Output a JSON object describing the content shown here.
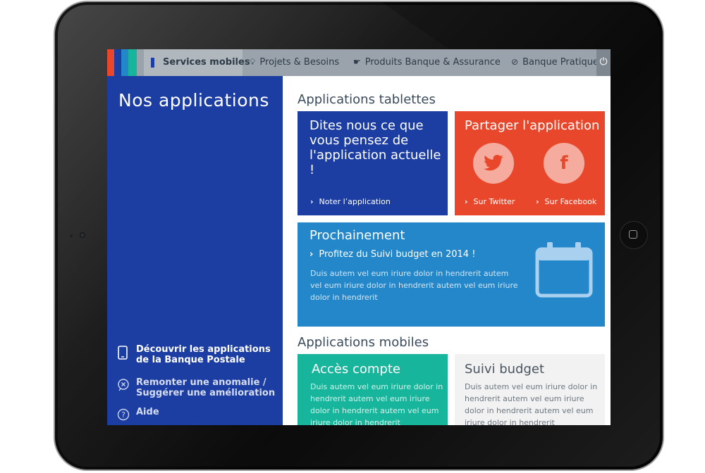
{
  "nav": {
    "items": [
      {
        "label": "Services mobiles",
        "icon": "phone-icon"
      },
      {
        "label": "Projets & Besoins",
        "icon": "lightbulb-icon"
      },
      {
        "label": "Produits Banque & Assurance",
        "icon": "handshake-icon"
      },
      {
        "label": "Banque Pratique",
        "icon": "compass-icon"
      }
    ],
    "power_icon": "power-icon"
  },
  "sidebar": {
    "title": "Nos applications",
    "menu": [
      {
        "label": "Découvrir les applications de la Banque Postale",
        "icon": "tablet-icon"
      },
      {
        "label": "Remonter une anomalie / Suggérer une amélioration",
        "icon": "bug-report-icon"
      },
      {
        "label": "Aide",
        "icon": "help-icon"
      }
    ]
  },
  "main": {
    "tablet_section": "Applications tablettes",
    "mobile_section": "Applications mobiles",
    "feedback": {
      "title": "Dites nous ce que vous pensez de l'application actuelle !",
      "link": "Noter l’application"
    },
    "share": {
      "title": "Partager l'application",
      "twitter": "Sur Twitter",
      "facebook": "Sur Facebook"
    },
    "upcoming": {
      "title": "Prochainement",
      "subtitle": "Profitez du Suivi budget en 2014 !",
      "text": "Duis autem vel eum iriure dolor in hendrerit  autem vel eum iriure dolor in hendrerit autem vel eum iriure dolor in hendrerit"
    },
    "acces": {
      "title": "Accès compte",
      "text": "Duis autem vel eum iriure dolor in hendrerit autem vel eum iriure dolor in hendrerit autem vel eum iriure dolor in hendrerit"
    },
    "suivi": {
      "title": "Suivi budget",
      "text": "Duis autem vel eum iriure dolor in hendrerit autem vel eum iriure dolor in hendrerit autem vel eum iriure dolor in hendrerit"
    }
  },
  "colors": {
    "red": "#e8472b",
    "blue": "#1c3da1",
    "cyan": "#2487c9",
    "teal": "#17b59b"
  }
}
